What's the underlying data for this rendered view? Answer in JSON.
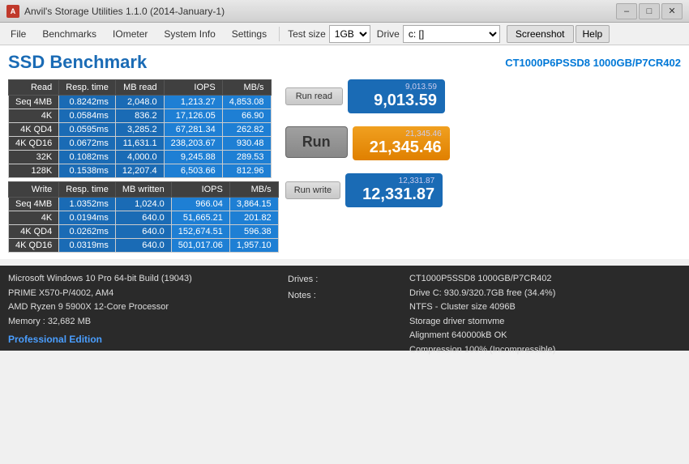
{
  "titleBar": {
    "title": "Anvil's Storage Utilities 1.1.0 (2014-January-1)",
    "icon": "A"
  },
  "menuBar": {
    "file": "File",
    "benchmarks": "Benchmarks",
    "iometer": "IOmeter",
    "systemInfo": "System Info",
    "settings": "Settings",
    "testSizeLabel": "Test size",
    "testSizeValue": "1GB",
    "driveLabel": "Drive",
    "driveValue": "c: []",
    "screenshot": "Screenshot",
    "help": "Help"
  },
  "header": {
    "title": "SSD Benchmark",
    "driveModel": "CT1000P6PSSD8 1000GB/P7CR402"
  },
  "readTable": {
    "headers": [
      "Read",
      "Resp. time",
      "MB read",
      "IOPS",
      "MB/s"
    ],
    "rows": [
      [
        "Seq 4MB",
        "0.8242ms",
        "2,048.0",
        "1,213.27",
        "4,853.08"
      ],
      [
        "4K",
        "0.0584ms",
        "836.2",
        "17,126.05",
        "66.90"
      ],
      [
        "4K QD4",
        "0.0595ms",
        "3,285.2",
        "67,281.34",
        "262.82"
      ],
      [
        "4K QD16",
        "0.0672ms",
        "11,631.1",
        "238,203.67",
        "930.48"
      ],
      [
        "32K",
        "0.1082ms",
        "4,000.0",
        "9,245.88",
        "289.53"
      ],
      [
        "128K",
        "0.1538ms",
        "12,207.4",
        "6,503.66",
        "812.96"
      ]
    ]
  },
  "writeTable": {
    "headers": [
      "Write",
      "Resp. time",
      "MB written",
      "IOPS",
      "MB/s"
    ],
    "rows": [
      [
        "Seq 4MB",
        "1.0352ms",
        "1,024.0",
        "966.04",
        "3,864.15"
      ],
      [
        "4K",
        "0.0194ms",
        "640.0",
        "51,665.21",
        "201.82"
      ],
      [
        "4K QD4",
        "0.0262ms",
        "640.0",
        "152,674.51",
        "596.38"
      ],
      [
        "4K QD16",
        "0.0319ms",
        "640.0",
        "501,017.06",
        "1,957.10"
      ]
    ]
  },
  "scores": {
    "runReadLabel": "Run read",
    "readScoreSmall": "9,013.59",
    "readScoreBig": "9,013.59",
    "runLabel": "Run",
    "runScoreSmall": "21,345.46",
    "runScoreBig": "21,345.46",
    "runWriteLabel": "Run write",
    "writeScoreSmall": "12,331.87",
    "writeScoreBig": "12,331.87"
  },
  "systemInfo": {
    "os": "Microsoft Windows 10 Pro 64-bit Build (19043)",
    "motherboard": "PRIME X570-P/4002, AM4",
    "cpu": "AMD Ryzen 9 5900X 12-Core Processor",
    "memory": "Memory : 32,682 MB",
    "proEdition": "Professional Edition",
    "drivesLabel": "Drives :",
    "notesLabel": "Notes :"
  },
  "driveInfo": {
    "model": "CT1000P5SSD8 1000GB/P7CR402",
    "freeSpace": "Drive C: 930.9/320.7GB free (34.4%)",
    "filesystem": "NTFS - Cluster size 4096B",
    "storageDriver": "Storage driver  stornvme",
    "alignment": "Alignment 640000kB OK",
    "compression": "Compression 100% (Incompressible)"
  }
}
